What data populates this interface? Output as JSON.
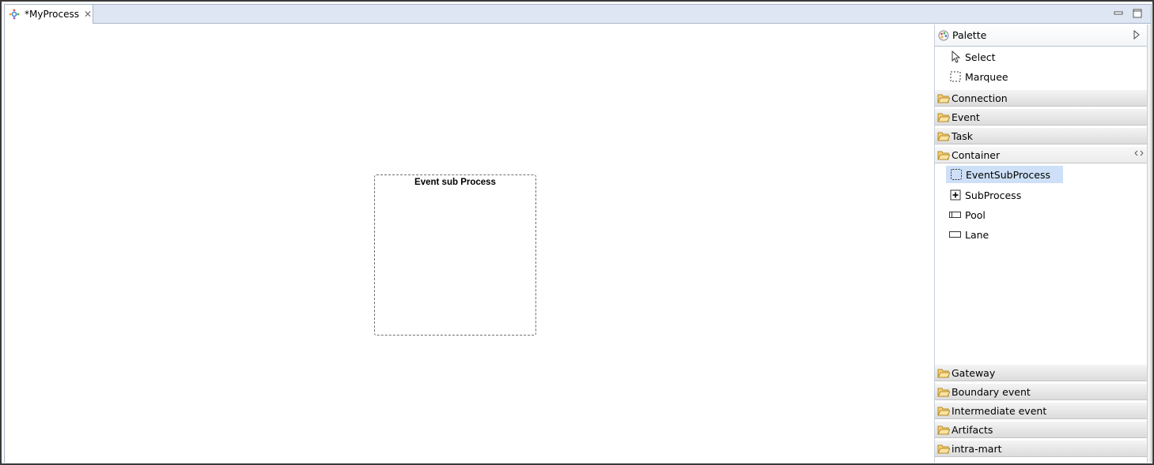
{
  "editor": {
    "tab_title": "*MyProcess",
    "tab_close_glyph": "✕",
    "minimize_glyph": "▭",
    "maximize_glyph": "□"
  },
  "canvas": {
    "subprocess_title": "Event sub Process"
  },
  "palette": {
    "title": "Palette",
    "tools": [
      {
        "label": "Select",
        "icon": "select-arrow-icon"
      },
      {
        "label": "Marquee",
        "icon": "marquee-icon"
      }
    ],
    "drawers_top": [
      {
        "label": "Connection"
      },
      {
        "label": "Event"
      },
      {
        "label": "Task"
      },
      {
        "label": "Container"
      }
    ],
    "container_items": [
      {
        "label": "EventSubProcess",
        "icon": "event-subprocess-icon",
        "selected": true
      },
      {
        "label": "SubProcess",
        "icon": "subprocess-icon"
      },
      {
        "label": "Pool",
        "icon": "pool-icon"
      },
      {
        "label": "Lane",
        "icon": "lane-icon"
      }
    ],
    "drawers_bottom": [
      {
        "label": "Gateway"
      },
      {
        "label": "Boundary event"
      },
      {
        "label": "Intermediate event"
      },
      {
        "label": "Artifacts"
      },
      {
        "label": "intra-mart"
      }
    ]
  },
  "colors": {
    "tabbar_bg": "#dde6f2",
    "selection": "#cde0f7",
    "folder": "#e8b84a"
  }
}
